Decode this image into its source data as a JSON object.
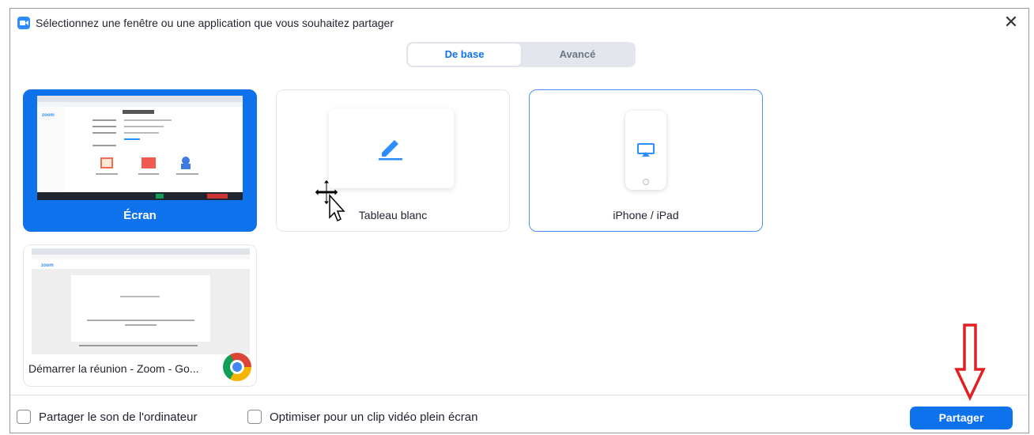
{
  "window": {
    "title": "Sélectionnez une fenêtre ou une application que vous souhaitez partager",
    "close_glyph": "✕"
  },
  "tabs": [
    {
      "label": "De base",
      "active": true
    },
    {
      "label": "Avancé",
      "active": false
    }
  ],
  "cards": {
    "screen": {
      "label": "Écran",
      "selected": true
    },
    "whiteboard": {
      "label": "Tableau blanc"
    },
    "iphone": {
      "label": "iPhone / iPad"
    },
    "chrome": {
      "label": "Démarrer la réunion - Zoom - Go...",
      "icon": "chrome-icon"
    }
  },
  "footer": {
    "share_sound_label": "Partager le son de l'ordinateur",
    "share_sound_checked": false,
    "optimize_video_label": "Optimiser pour un clip vidéo plein écran",
    "optimize_video_checked": false,
    "share_button_label": "Partager"
  },
  "colors": {
    "accent": "#0e72ed",
    "annotation_arrow": "#e02020"
  }
}
